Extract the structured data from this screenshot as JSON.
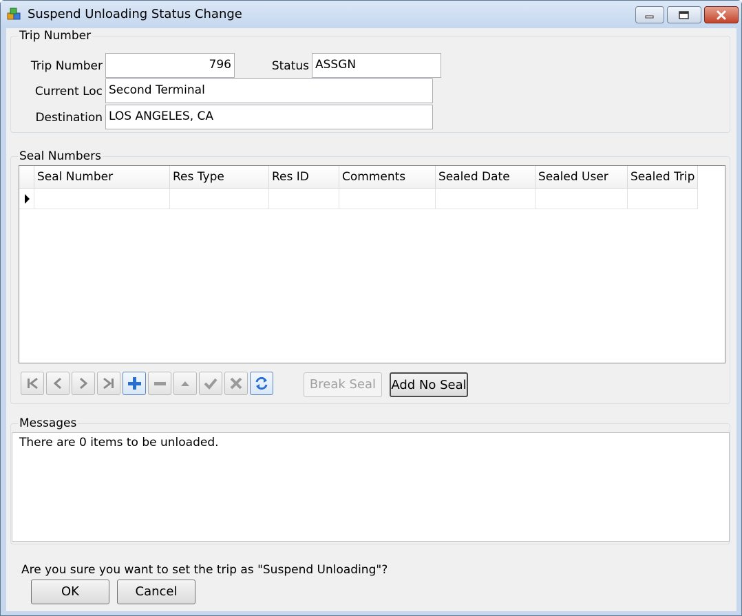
{
  "window": {
    "title": "Suspend Unloading Status Change"
  },
  "trip_group": {
    "label": "Trip Number",
    "trip_number_label": "Trip Number",
    "trip_number_value": "796",
    "status_label": "Status",
    "status_value": "ASSGN",
    "current_loc_label": "Current Loc",
    "current_loc_value": "Second Terminal",
    "destination_label": "Destination",
    "destination_value": "LOS ANGELES, CA"
  },
  "seal_group": {
    "label": "Seal Numbers",
    "columns": [
      "Seal Number",
      "Res Type",
      "Res ID",
      "Comments",
      "Sealed Date",
      "Sealed User",
      "Sealed Trip"
    ],
    "rows": [
      [
        "",
        "",
        "",
        "",
        "",
        "",
        ""
      ]
    ],
    "navigator_icons": [
      "first-record-icon",
      "previous-record-icon",
      "next-record-icon",
      "last-record-icon",
      "add-record-icon",
      "delete-record-icon",
      "up-icon",
      "post-check-icon",
      "cancel-x-icon",
      "refresh-icon"
    ],
    "break_seal_label": "Break Seal",
    "add_no_seal_label": "Add No Seal"
  },
  "messages_group": {
    "label": "Messages",
    "text": "There are 0 items to be unloaded."
  },
  "footer": {
    "question": "Are you sure you want to set the trip as \"Suspend Unloading\"?",
    "ok_label": "OK",
    "cancel_label": "Cancel"
  }
}
